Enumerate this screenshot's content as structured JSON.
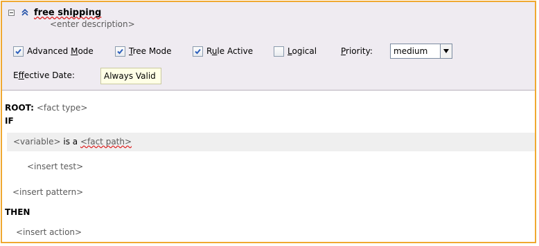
{
  "rule": {
    "name": "free shipping",
    "description_placeholder": "<enter description>",
    "options": {
      "advanced_mode": {
        "label": "Advanced Mode",
        "mnemonic_pre": "Advanced ",
        "mnemonic": "M",
        "mnemonic_post": "ode",
        "checked": true
      },
      "tree_mode": {
        "label": "Tree Mode",
        "mnemonic_pre": "",
        "mnemonic": "T",
        "mnemonic_post": "ree Mode",
        "checked": true
      },
      "rule_active": {
        "label": "Rule Active",
        "mnemonic_pre": "R",
        "mnemonic": "u",
        "mnemonic_post": "le Active",
        "checked": true
      },
      "logical": {
        "label": "Logical",
        "mnemonic_pre": "",
        "mnemonic": "L",
        "mnemonic_post": "ogical",
        "checked": false
      }
    },
    "priority": {
      "label": "Priority:",
      "mnemonic_pre": "",
      "mnemonic": "P",
      "mnemonic_post": "riority:",
      "selected": "medium"
    },
    "effective_date": {
      "label": "Effective Date:",
      "mnemonic_pre": "E",
      "mnemonic": "f",
      "mnemonic_post": "fective Date:",
      "value": "Always Valid"
    }
  },
  "body": {
    "root_label": "ROOT:",
    "root_fact_type": "<fact type>",
    "if_label": "IF",
    "pattern": {
      "variable": "<variable>",
      "connector": "is a",
      "fact_path": "<fact path>"
    },
    "insert_test": "<insert test>",
    "insert_pattern": "<insert pattern>",
    "then_label": "THEN",
    "insert_action": "<insert action>"
  },
  "colors": {
    "frame_border": "#f0a830",
    "header_bg": "#efebf1",
    "field_bg": "#ffffe6",
    "checkbox_check": "#2c5ebc"
  }
}
